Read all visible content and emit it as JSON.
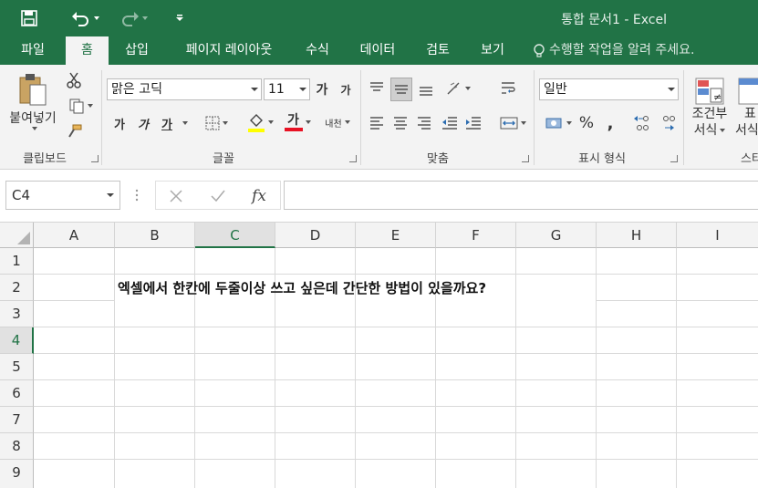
{
  "titlebar": {
    "title": "통합 문서1 - Excel",
    "save_icon": "save-icon",
    "undo_icon": "undo-icon",
    "redo_icon": "redo-icon",
    "customize_icon": "customize-quick-access-icon"
  },
  "tabs": [
    {
      "label": "파일",
      "active": false
    },
    {
      "label": "홈",
      "active": true
    },
    {
      "label": "삽입",
      "active": false
    },
    {
      "label": "페이지 레이아웃",
      "active": false
    },
    {
      "label": "수식",
      "active": false
    },
    {
      "label": "데이터",
      "active": false
    },
    {
      "label": "검토",
      "active": false
    },
    {
      "label": "보기",
      "active": false
    }
  ],
  "tell_me": "수행할 작업을 알려 주세요.",
  "ribbon": {
    "clipboard": {
      "paste_label": "붙여넣기",
      "group_label": "클립보드"
    },
    "font": {
      "font_name": "맑은 고딕",
      "font_size": "11",
      "grow_label": "가",
      "shrink_label": "가",
      "bold_label": "가",
      "italic_label": "가",
      "underline_label": "가",
      "font_color_label": "가",
      "phonetic_label": "내천",
      "group_label": "글꼴"
    },
    "alignment": {
      "group_label": "맞춤"
    },
    "number": {
      "format": "일반",
      "percent_label": "%",
      "comma_label": ",",
      "group_label": "표시 형식"
    },
    "styles": {
      "conditional_label_1": "조건부",
      "conditional_label_2": "서식",
      "table_label_1": "표",
      "table_label_2": "서식",
      "group_label": "스타"
    }
  },
  "formula_bar": {
    "name_box": "C4",
    "fx_label": "fx",
    "formula": ""
  },
  "grid": {
    "columns": [
      "A",
      "B",
      "C",
      "D",
      "E",
      "F",
      "G",
      "H",
      "I"
    ],
    "rows": [
      "1",
      "2",
      "3",
      "4",
      "5",
      "6",
      "7",
      "8",
      "9"
    ],
    "cell_b2": "엑셀에서 한칸에 두줄이상 쓰고 싶은데 간단한 방법이 있을까요?"
  },
  "colors": {
    "brand": "#217346",
    "ribbon_bg": "#f3f3f3",
    "font_color_bar": "#e81123",
    "highlight_bar": "#ffff00"
  }
}
